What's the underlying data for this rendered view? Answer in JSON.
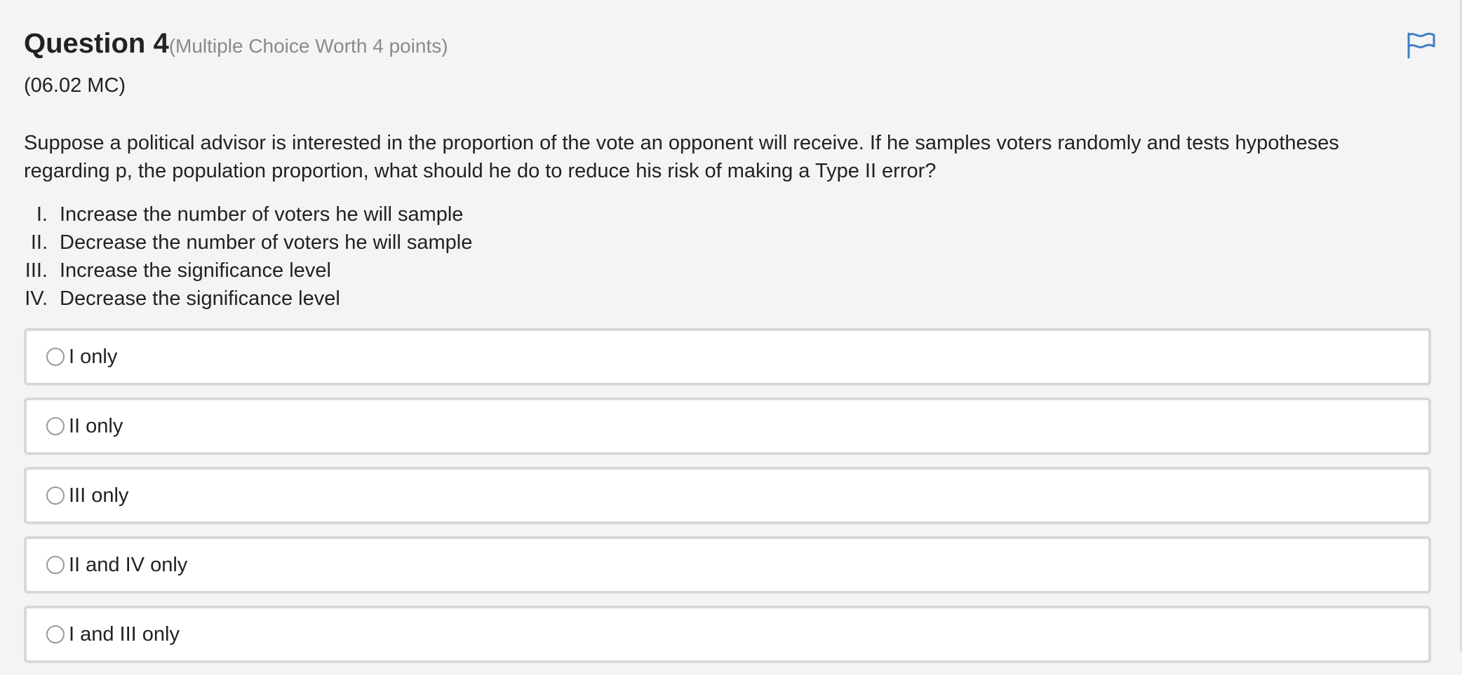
{
  "question": {
    "title": "Question 4",
    "worth": "(Multiple Choice Worth 4 points)",
    "code": "(06.02 MC)",
    "stem": "Suppose a political advisor is interested in the proportion of the vote an opponent will receive. If he samples voters randomly and tests hypotheses regarding p, the population proportion, what should he do to reduce his risk of making a Type II error?",
    "statements": [
      {
        "num": "I.",
        "text": "Increase the number of voters he will sample"
      },
      {
        "num": "II.",
        "text": "Decrease the number of voters he will sample"
      },
      {
        "num": "III.",
        "text": "Increase the significance level"
      },
      {
        "num": "IV.",
        "text": "Decrease the significance level"
      }
    ]
  },
  "choices": [
    {
      "label": "I only"
    },
    {
      "label": "II only"
    },
    {
      "label": "III only"
    },
    {
      "label": "II and IV only"
    },
    {
      "label": "I and III only"
    }
  ],
  "flag_icon": "flag-icon",
  "colors": {
    "background": "#f4f4f4",
    "flag": "#3f7fc4",
    "choice_border": "#d8d8d8",
    "worth_text": "#8a8a8a"
  }
}
